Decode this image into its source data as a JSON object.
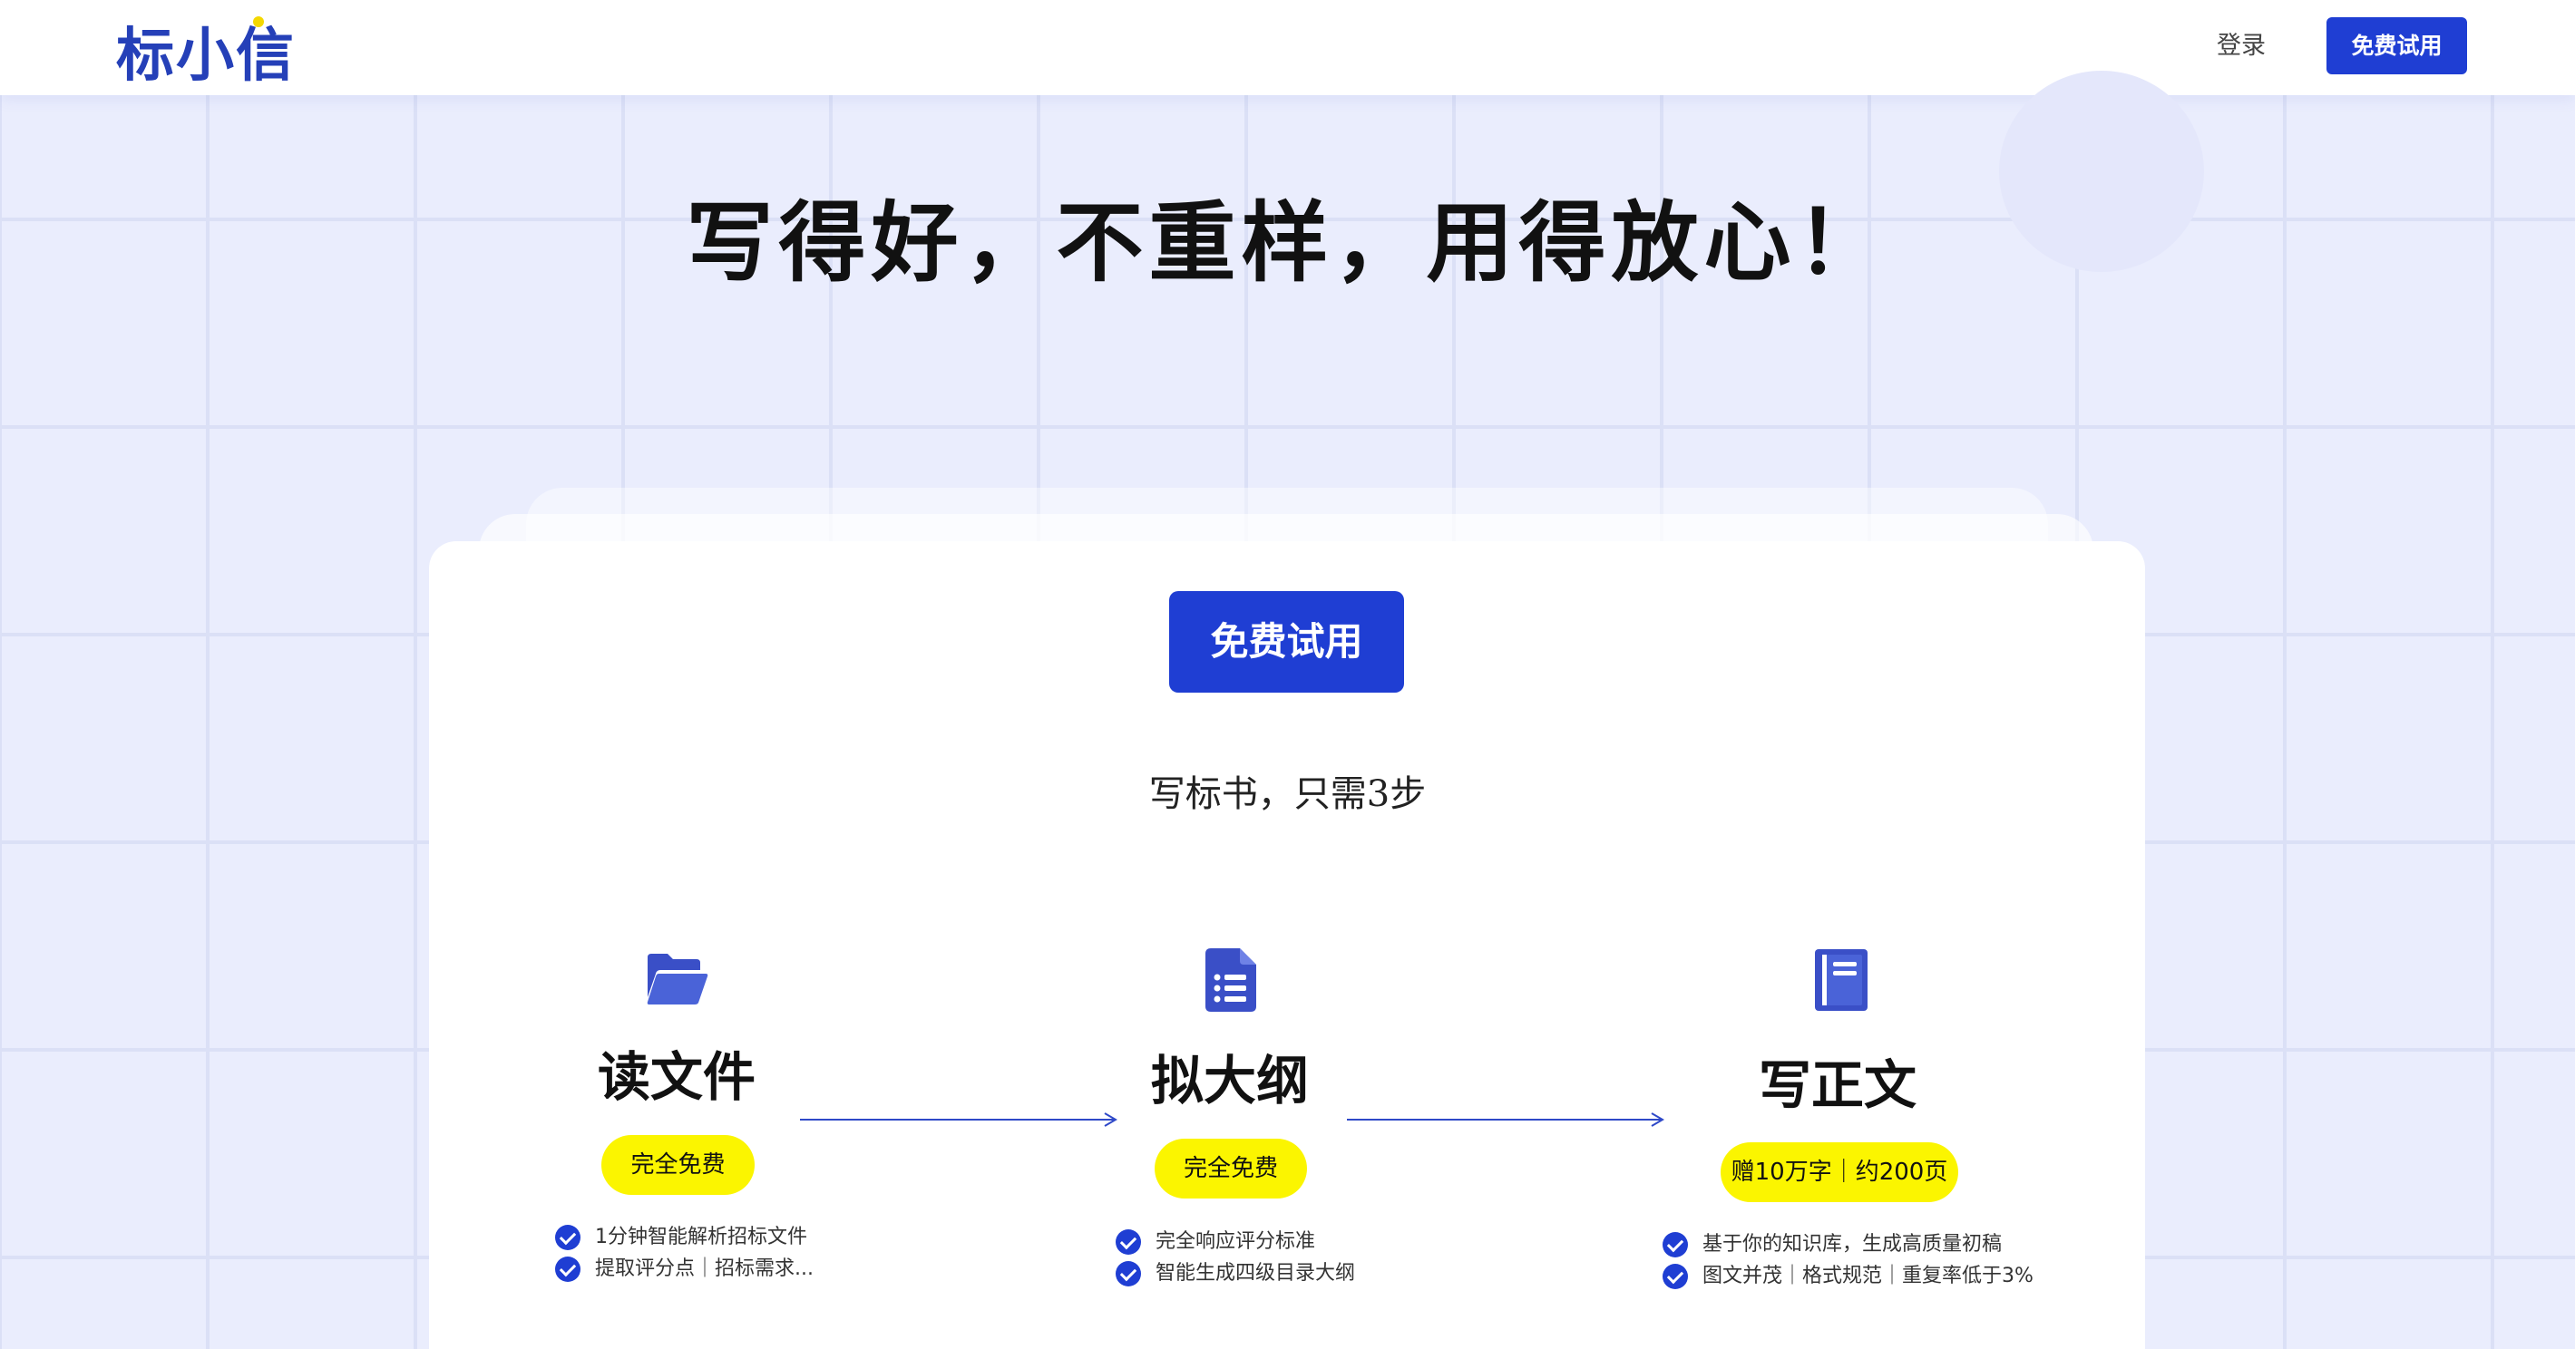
{
  "brand": {
    "logo_text": "标小信",
    "accent_color": "#1f3ed3",
    "highlight_color": "#fbf500"
  },
  "header": {
    "login_label": "登录",
    "cta_label": "免费试用"
  },
  "hero": {
    "headline": "写得好，不重样，用得放心！",
    "cta_label": "免费试用",
    "subtitle": "写标书，只需3步"
  },
  "steps": [
    {
      "icon": "folder-open-icon",
      "title": "读文件",
      "badge": "完全免费",
      "features": [
        "1分钟智能解析招标文件",
        "提取评分点｜招标需求..."
      ]
    },
    {
      "icon": "file-list-icon",
      "title": "拟大纲",
      "badge": "完全免费",
      "features": [
        "完全响应评分标准",
        "智能生成四级目录大纲"
      ]
    },
    {
      "icon": "book-icon",
      "title": "写正文",
      "badge": "赠10万字｜约200页",
      "features": [
        "基于你的知识库，生成高质量初稿",
        "图文并茂｜格式规范｜重复率低于3%"
      ]
    }
  ]
}
